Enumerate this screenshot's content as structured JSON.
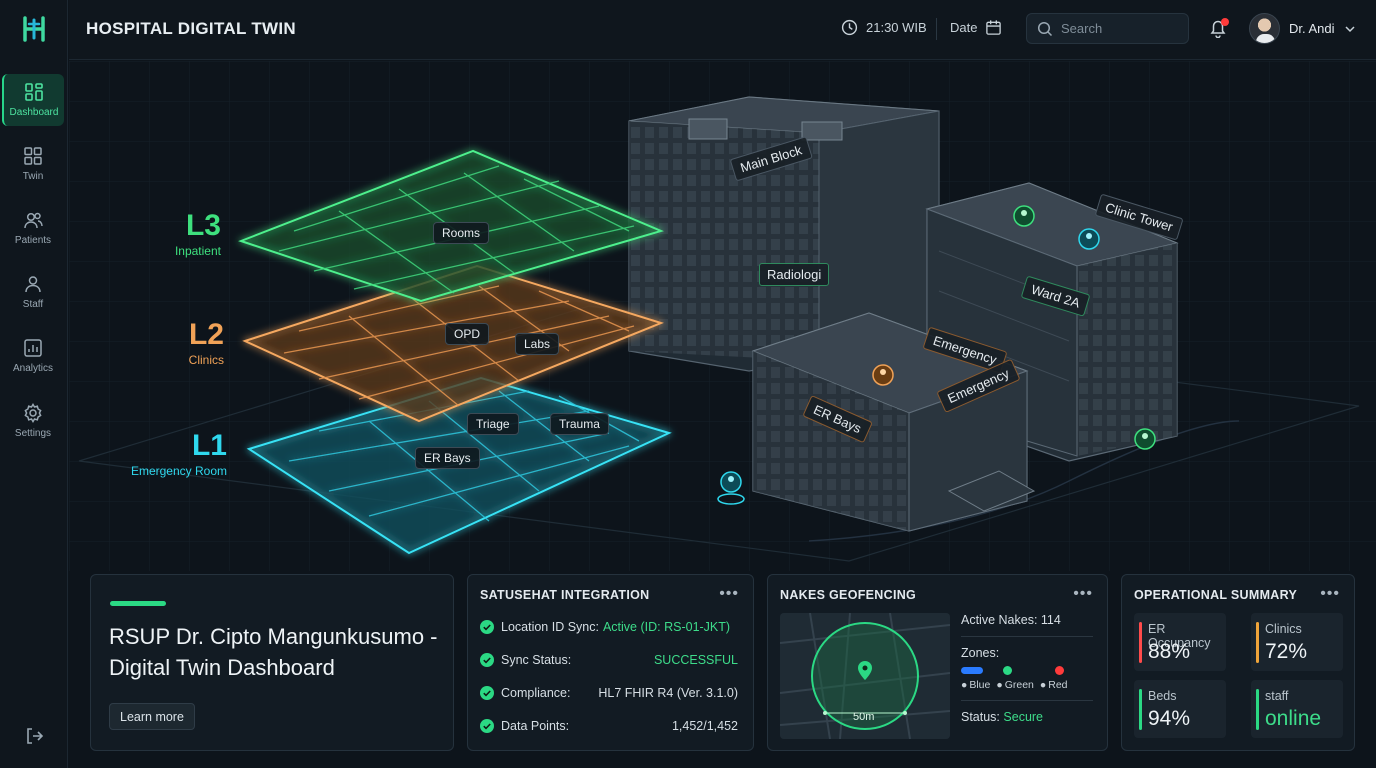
{
  "header": {
    "title": "HOSPITAL DIGITAL TWIN",
    "time": "21:30 WIB",
    "date_label": "Date",
    "search_placeholder": "Search",
    "user_name": "Dr. Andi"
  },
  "sidebar": {
    "items": [
      {
        "label": "Dashboard",
        "icon": "dashboard-icon",
        "active": true
      },
      {
        "label": "Twin",
        "icon": "twin-icon"
      },
      {
        "label": "Patients",
        "icon": "patients-icon"
      },
      {
        "label": "Staff",
        "icon": "staff-icon"
      },
      {
        "label": "Analytics",
        "icon": "analytics-icon"
      },
      {
        "label": "Settings",
        "icon": "settings-icon"
      }
    ]
  },
  "scene": {
    "levels": [
      {
        "code": "L3",
        "name": "Inpatient",
        "color": "#3ee07e"
      },
      {
        "code": "L2",
        "name": "Clinics",
        "color": "#f0a257"
      },
      {
        "code": "L1",
        "name": "Emergency Room",
        "color": "#2fd8ee"
      }
    ],
    "floor_tags": [
      "Rooms",
      "OPD",
      "Labs",
      "Triage",
      "Trauma",
      "ER Bays"
    ],
    "building_tags": [
      "Main Block",
      "Clinic Tower",
      "Radiologi",
      "Ward 2A",
      "Emergency",
      "ER Bays",
      "Emergency"
    ]
  },
  "intro_card": {
    "text": "RSUP Dr. Cipto Mangunkusumo - Digital Twin Dashboard",
    "button": "Learn more"
  },
  "satusehat": {
    "title": "SATUSEHAT INTEGRATION",
    "rows": [
      {
        "key": "Location ID Sync:",
        "value": "Active (ID: RS-01-JKT)"
      },
      {
        "key": "Sync Status:",
        "value": "SUCCESSFUL"
      },
      {
        "key": "Compliance:",
        "value": "HL7 FHIR R4 (Ver. 3.1.0)"
      },
      {
        "key": "Data Points:",
        "value": "1,452/1,452"
      }
    ]
  },
  "geofencing": {
    "title": "NAKES GEOFENCING",
    "active": "Active Nakes: 114",
    "zones_label": "Zones:",
    "zones": [
      "Blue",
      "Green",
      "Red"
    ],
    "status_label": "Status:",
    "status_value": "Secure",
    "radius": "50m",
    "zone_colors": [
      "#2a7bff",
      "#2bd984",
      "#ff3b3b"
    ]
  },
  "summary": {
    "title": "OPERATIONAL SUMMARY",
    "metrics": [
      {
        "label": "ER Occupancy",
        "value": "88%",
        "color": "#ff4b4b"
      },
      {
        "label": "Clinics",
        "value": "72%",
        "color": "#f0a53a"
      },
      {
        "label": "Beds",
        "value": "94%",
        "color": "#2bd984"
      },
      {
        "label": "staff",
        "value": "online",
        "color": "#2bd984"
      }
    ]
  }
}
